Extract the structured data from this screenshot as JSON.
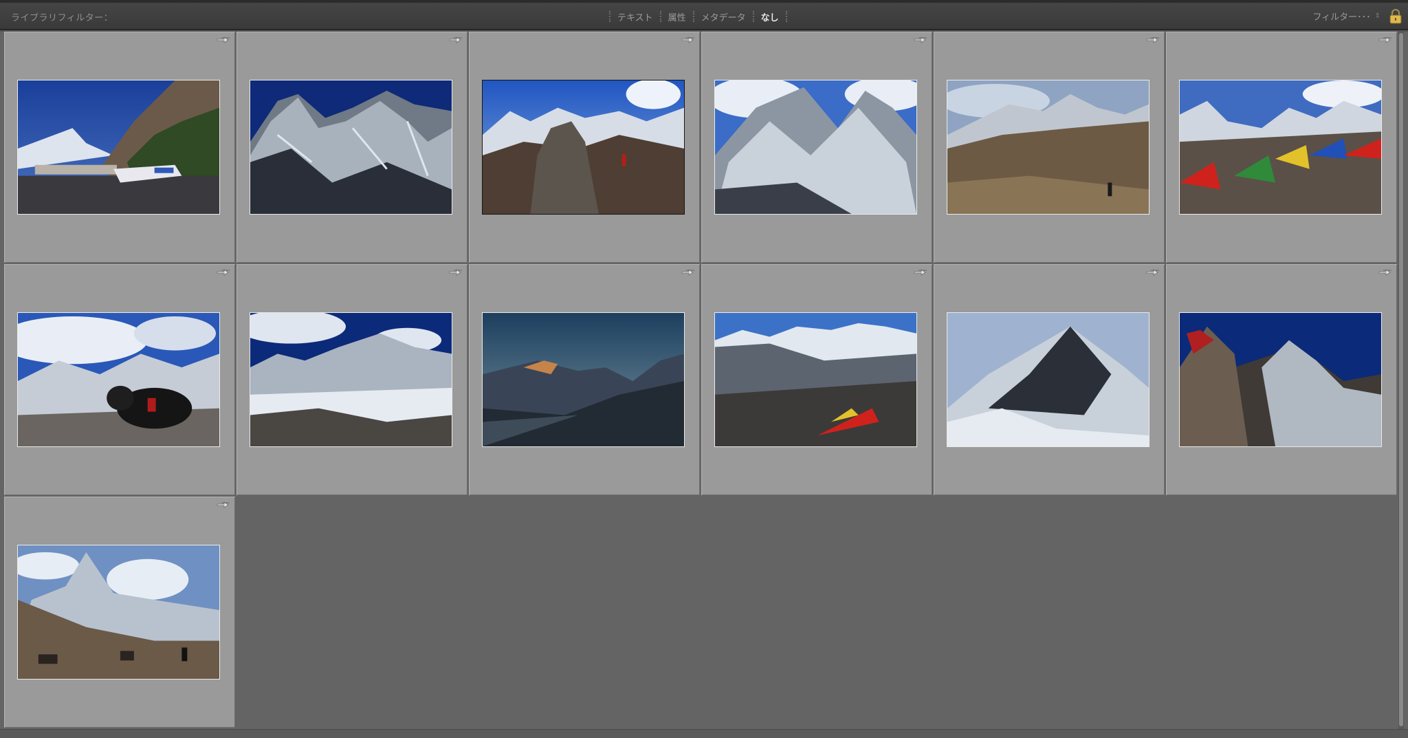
{
  "filterbar": {
    "library_filter_label": "ライブラリフィルター：",
    "tabs": [
      {
        "label": "テキスト"
      },
      {
        "label": "属性"
      },
      {
        "label": "メタデータ"
      },
      {
        "label": "なし",
        "active": true
      }
    ],
    "preset_label": "フィルター･･･",
    "preset_icon": "chevron-updown-icon",
    "lock_icon": "padlock-icon"
  },
  "grid": {
    "columns": 6,
    "badge_icon": "rotate-arrows-icon",
    "photos": [
      {
        "name": "photo-lukla-airstrip",
        "selected": false
      },
      {
        "name": "photo-everest-lhotse-wall",
        "selected": false
      },
      {
        "name": "photo-rocky-summit-hiker",
        "selected": true
      },
      {
        "name": "photo-nuptse-peaks",
        "selected": false
      },
      {
        "name": "photo-valley-trekker",
        "selected": false
      },
      {
        "name": "photo-prayer-flags",
        "selected": false
      },
      {
        "name": "photo-yak",
        "selected": false
      },
      {
        "name": "photo-khumbu-glacier",
        "selected": false
      },
      {
        "name": "photo-dusk-valley",
        "selected": false
      },
      {
        "name": "photo-gokyo-ri-flags",
        "selected": false
      },
      {
        "name": "photo-everest-pyramid",
        "selected": false
      },
      {
        "name": "photo-kala-patthar",
        "selected": false
      },
      {
        "name": "photo-ama-dablam-yaks",
        "selected": false
      }
    ]
  },
  "colors": {
    "panel_bg": "#646464",
    "cell_bg": "#9a9a9a",
    "active_tab": "#e6e6e6",
    "lock_accent": "#e0b94a"
  }
}
